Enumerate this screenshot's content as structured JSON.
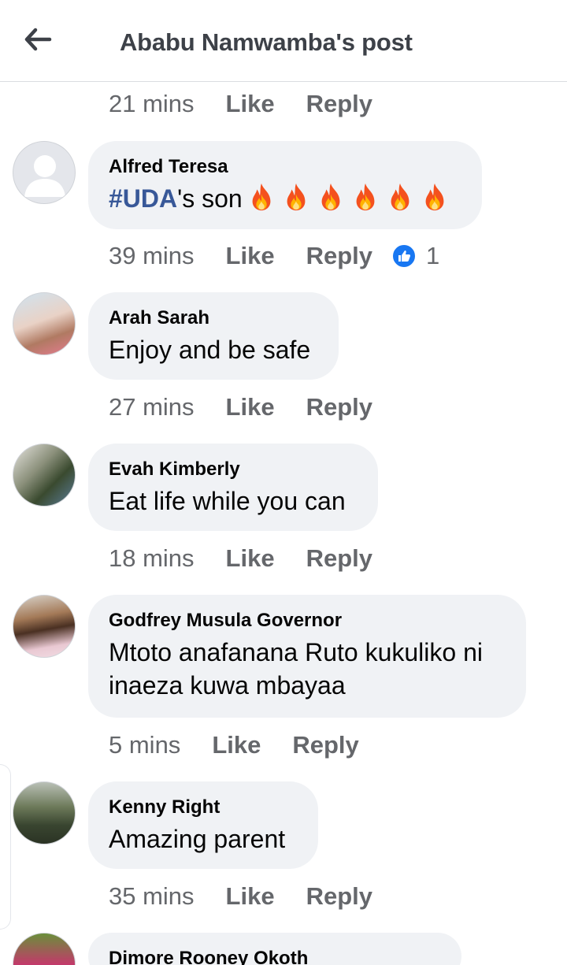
{
  "header": {
    "title": "Ababu Namwamba's post"
  },
  "actions": {
    "like": "Like",
    "reply": "Reply"
  },
  "top_meta": {
    "time": "21 mins"
  },
  "comments": [
    {
      "author": "Alfred Teresa",
      "hashtag": "#UDA",
      "text": "'s son",
      "emoji": "fire x6",
      "time": "39 mins",
      "reactions": "1"
    },
    {
      "author": "Arah Sarah",
      "text": "Enjoy and be safe",
      "time": "27 mins"
    },
    {
      "author": "Evah Kimberly",
      "text": "Eat life while you can",
      "time": "18 mins"
    },
    {
      "author": "Godfrey Musula Governor",
      "text": "Mtoto anafanana Ruto kukuliko ni inaeza kuwa mbayaa",
      "time": "5 mins"
    },
    {
      "author": "Kenny Right",
      "text": "Amazing parent",
      "time": "35 mins"
    },
    {
      "author": "Dimore Rooney Okoth"
    }
  ],
  "colors": {
    "hashtag": "#385898",
    "like_badge": "#1877f2",
    "bubble": "#f0f2f5",
    "meta": "#65676b"
  },
  "icons": {
    "back": "arrow-left-icon",
    "like": "thumbs-up-icon",
    "fire": "fire-emoji-icon"
  }
}
